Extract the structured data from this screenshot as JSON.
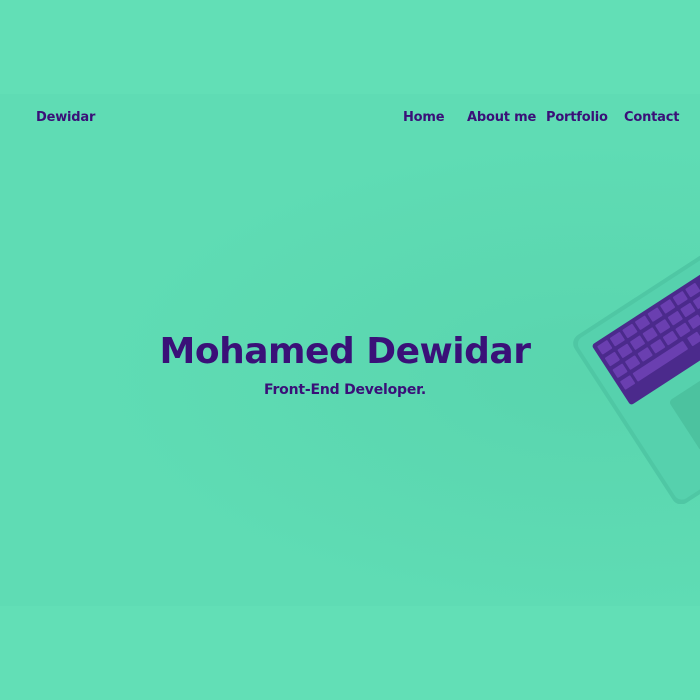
{
  "theme": {
    "background": "#62dfb6",
    "accent": "#3a1078"
  },
  "header": {
    "brand": "Dewidar",
    "nav": [
      {
        "label": "Home"
      },
      {
        "label": "About me"
      },
      {
        "label": "Portfolio"
      },
      {
        "label": "Contact"
      }
    ]
  },
  "hero": {
    "title": "Mohamed Dewidar",
    "subtitle": "Front-End Developer."
  },
  "decor": {
    "image_icon": "laptop-icon"
  }
}
